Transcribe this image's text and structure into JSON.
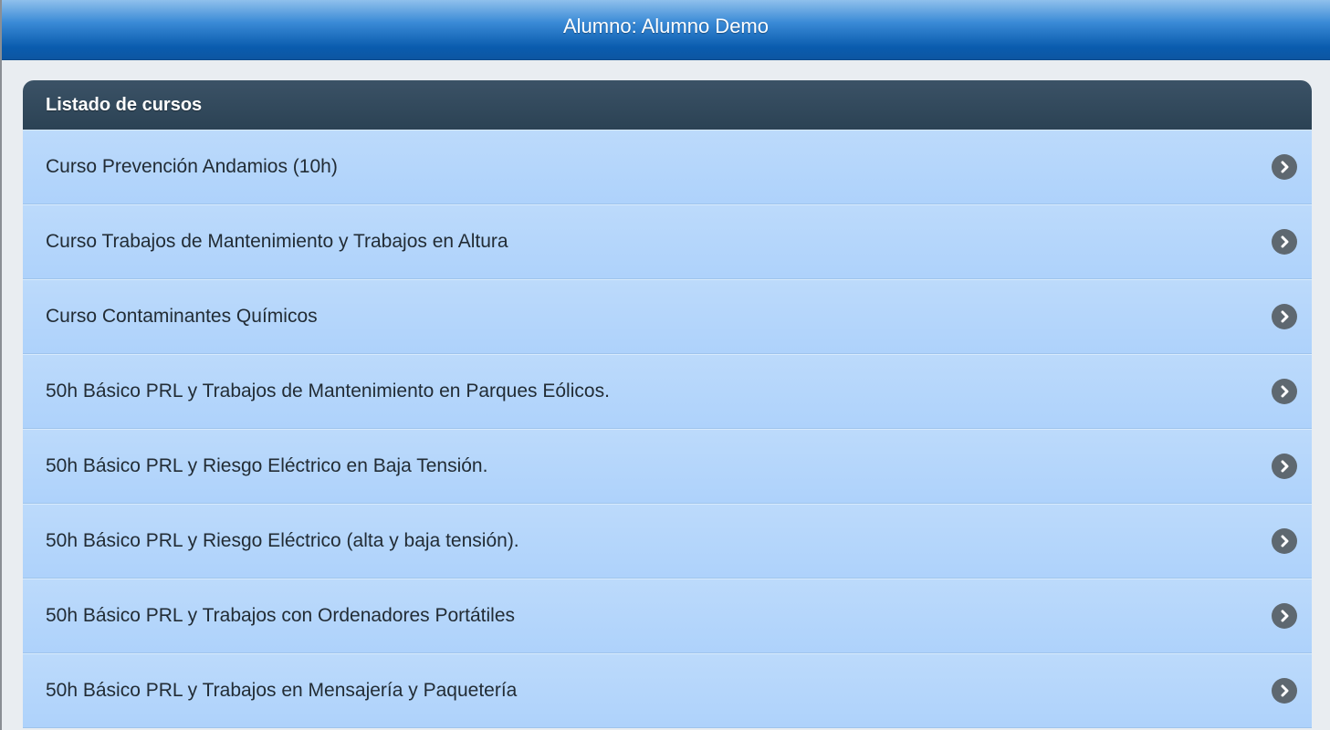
{
  "header": {
    "title": "Alumno: Alumno Demo"
  },
  "panel": {
    "title": "Listado de cursos",
    "items": [
      {
        "label": "Curso Prevención Andamios (10h)",
        "icon": "chevron-right-icon"
      },
      {
        "label": "Curso Trabajos de Mantenimiento y Trabajos en Altura",
        "icon": "chevron-right-icon"
      },
      {
        "label": "Curso Contaminantes Químicos",
        "icon": "chevron-right-icon"
      },
      {
        "label": "50h Básico PRL y Trabajos de Mantenimiento en Parques Eólicos.",
        "icon": "chevron-right-icon"
      },
      {
        "label": "50h Básico PRL y Riesgo Eléctrico en Baja Tensión.",
        "icon": "chevron-right-icon"
      },
      {
        "label": "50h Básico PRL y Riesgo Eléctrico (alta y baja tensión).",
        "icon": "chevron-right-icon"
      },
      {
        "label": "50h Básico PRL y Trabajos con Ordenadores Portátiles",
        "icon": "chevron-right-icon"
      },
      {
        "label": "50h Básico PRL y Trabajos en Mensajería y Paquetería",
        "icon": "chevron-right-icon"
      }
    ]
  },
  "colors": {
    "header_blue": "#0a5cae",
    "panel_header": "#2b4254",
    "item_background": "#b4d6fb",
    "arrow_icon": "#5e6870"
  }
}
